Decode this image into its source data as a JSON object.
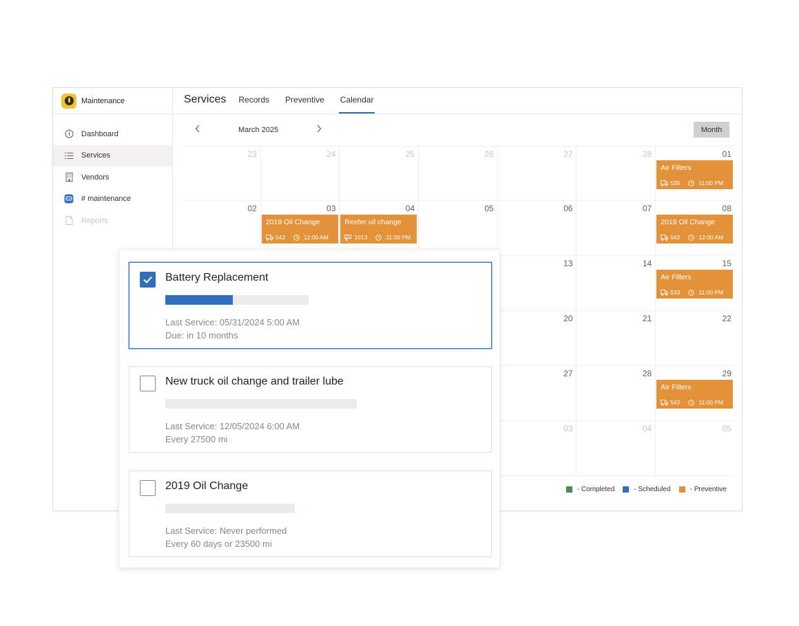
{
  "app": {
    "name": "Maintenance"
  },
  "sidebar": {
    "items": [
      {
        "label": "Dashboard",
        "icon": "dashboard-icon"
      },
      {
        "label": "Services",
        "icon": "list-icon"
      },
      {
        "label": "Vendors",
        "icon": "building-icon"
      },
      {
        "label": "# maintenance",
        "icon": "chat-icon"
      },
      {
        "label": "Reports",
        "icon": "document-icon"
      }
    ]
  },
  "header": {
    "title": "Services",
    "tabs": [
      "Records",
      "Preventive",
      "Calendar"
    ]
  },
  "calendar": {
    "month_label": "March 2025",
    "view_button": "Month",
    "days": [
      "23",
      "24",
      "25",
      "26",
      "27",
      "28",
      "01",
      "02",
      "03",
      "04",
      "05",
      "06",
      "07",
      "08",
      "",
      "",
      "",
      "",
      "13",
      "14",
      "15",
      "",
      "",
      "",
      "",
      "20",
      "21",
      "22",
      "",
      "",
      "",
      "",
      "27",
      "28",
      "29",
      "",
      "",
      "",
      "",
      "03",
      "04",
      "05"
    ],
    "events": [
      {
        "title": "Air Filters",
        "unit": "535",
        "time": "11:00 PM"
      },
      {
        "title": "2019 Oil Change",
        "unit": "543",
        "time": "12:00 AM"
      },
      {
        "title": "Reefer oil change",
        "unit": "1013",
        "time": "11:00 PM"
      },
      {
        "title": "2019 Oil Change",
        "unit": "542",
        "time": "12:00 AM"
      },
      {
        "title": "Air Filters",
        "unit": "533",
        "time": "11:00 PM"
      },
      {
        "title": "Air Filters",
        "unit": "542",
        "time": "11:00 PM"
      }
    ],
    "legend": [
      {
        "label": "- Completed",
        "color": "#4a8a5f"
      },
      {
        "label": "- Scheduled",
        "color": "#2f6fbd"
      },
      {
        "label": "- Preventive",
        "color": "#e3923a"
      }
    ]
  },
  "services": [
    {
      "title": "Battery Replacement",
      "checked": true,
      "progress": 0.47,
      "line1": "Last Service: 05/31/2024 5:00 AM",
      "line2": "Due: in 10 months"
    },
    {
      "title": "New truck oil change and trailer lube",
      "checked": false,
      "progress": 0,
      "line1": "Last Service: 12/05/2024 6:00 AM",
      "line2": "Every 27500 mi"
    },
    {
      "title": "2019 Oil Change",
      "checked": false,
      "progress": 0,
      "line1": "Last Service: Never performed",
      "line2": "Every 60 days or 23500 mi"
    }
  ],
  "colors": {
    "accent": "#2f6fbd",
    "preventive": "#e3923a",
    "logo": "#f2c230"
  }
}
